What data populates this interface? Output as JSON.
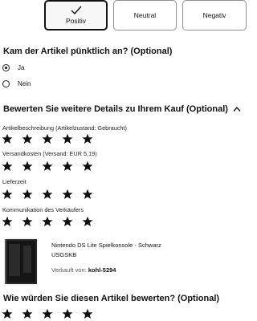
{
  "rating_buttons": [
    {
      "label": "Positiv",
      "selected": true
    },
    {
      "label": "Neutral",
      "selected": false
    },
    {
      "label": "Negativ",
      "selected": false
    }
  ],
  "punctual": {
    "question": "Kam der Artikel pünktlich an? (Optional)",
    "options": [
      {
        "label": "Ja",
        "selected": true
      },
      {
        "label": "Nein",
        "selected": false
      }
    ]
  },
  "details": {
    "title": "Bewerten Sie weitere Details zu Ihrem Kauf (Optional)",
    "expanded_icon": "chevron-up-icon",
    "criteria": [
      {
        "label": "Artikelbeschreibung (Artikelzustand: Gebraucht)",
        "stars": 5,
        "filled": 5
      },
      {
        "label": "Versandkosten (Versand: EUR 5,19)",
        "stars": 5,
        "filled": 5
      },
      {
        "label": "Lieferzeit",
        "stars": 5,
        "filled": 5
      },
      {
        "label": "Kommunikation des Verkäufers",
        "stars": 5,
        "filled": 5
      }
    ]
  },
  "product": {
    "title": "Nintendo DS Lite Spielkonsole - Schwarz USGSKB",
    "seller_prefix": "Verkauft von:",
    "seller_name": "kohl-5294"
  },
  "article_rating": {
    "question": "Wie würden Sie diesen Artikel bewerten? (Optional)",
    "stars": 5,
    "filled": 5
  },
  "colors": {
    "text": "#111111",
    "border": "#8f8f8f",
    "muted": "#555555"
  }
}
